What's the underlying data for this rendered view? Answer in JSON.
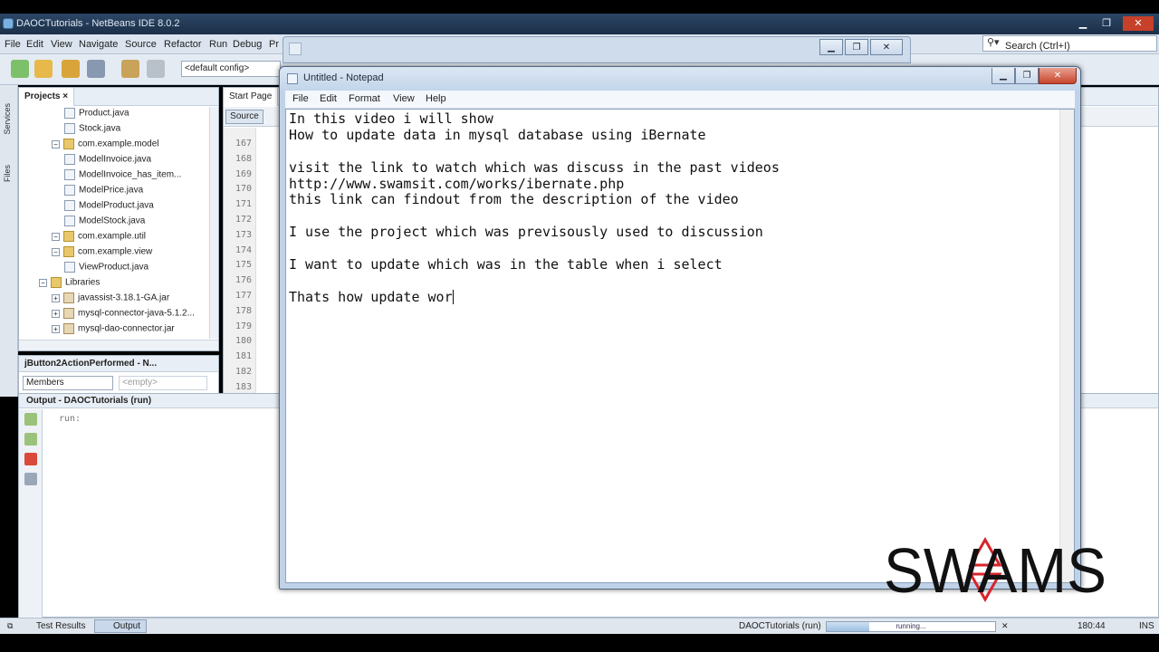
{
  "netbeans": {
    "title": "DAOCTutorials - NetBeans IDE 8.0.2",
    "window_controls": {
      "minimize": "▁",
      "maximize": "❐",
      "close": "✕"
    },
    "menu": [
      "File",
      "Edit",
      "View",
      "Navigate",
      "Source",
      "Refactor",
      "Run",
      "Debug",
      "Pr"
    ],
    "search_placeholder": "Search (Ctrl+I)",
    "config": "<default config>",
    "side_tabs": [
      "Services",
      "Files"
    ],
    "projects": {
      "tab": "Projects ×",
      "tree": [
        {
          "label": "Product.java",
          "type": "file",
          "indent": 3
        },
        {
          "label": "Stock.java",
          "type": "file",
          "indent": 3
        },
        {
          "label": "com.example.model",
          "type": "pkg",
          "indent": 2
        },
        {
          "label": "ModelInvoice.java",
          "type": "file",
          "indent": 3
        },
        {
          "label": "ModelInvoice_has_item...",
          "type": "file",
          "indent": 3
        },
        {
          "label": "ModelPrice.java",
          "type": "file",
          "indent": 3
        },
        {
          "label": "ModelProduct.java",
          "type": "file",
          "indent": 3
        },
        {
          "label": "ModelStock.java",
          "type": "file",
          "indent": 3
        },
        {
          "label": "com.example.util",
          "type": "pkg",
          "indent": 2
        },
        {
          "label": "com.example.view",
          "type": "pkg",
          "indent": 2
        },
        {
          "label": "ViewProduct.java",
          "type": "file",
          "indent": 3
        },
        {
          "label": "Libraries",
          "type": "pkg",
          "indent": 1
        },
        {
          "label": "javassist-3.18.1-GA.jar",
          "type": "jar",
          "indent": 2
        },
        {
          "label": "mysql-connector-java-5.1.2...",
          "type": "jar",
          "indent": 2
        },
        {
          "label": "mysql-dao-connector.jar",
          "type": "jar",
          "indent": 2
        }
      ]
    },
    "navigator": {
      "title": "jButton2ActionPerformed - N...",
      "members": "Members",
      "empty": "<empty>"
    },
    "editor": {
      "tabs": [
        "Start Page"
      ],
      "source_btn": "Source",
      "line_numbers": [
        "167",
        "168",
        "169",
        "170",
        "171",
        "172",
        "173",
        "174",
        "175",
        "176",
        "177",
        "178",
        "179",
        "180",
        "181",
        "182",
        "183"
      ]
    },
    "output": {
      "title": "Output - DAOCTutorials (run)",
      "text": "run:"
    },
    "statusbar": {
      "test_results": "Test Results",
      "output": "Output",
      "project_status": "DAOCTutorials (run)",
      "progress_text": "running...",
      "progress": 0.25,
      "position": "180:44",
      "mode": "INS"
    }
  },
  "notepad": {
    "title": "Untitled - Notepad",
    "menu": [
      "File",
      "Edit",
      "Format",
      "View",
      "Help"
    ],
    "lines": [
      "In this video i will show",
      "How to update data in mysql database using iBernate",
      "",
      "visit the link to watch which was discuss in the past videos",
      "http://www.swamsit.com/works/ibernate.php",
      "this link can findout from the description of the video",
      "",
      "I use the project which was previsously used to discussion",
      "",
      "I want to update which was in the table when i select",
      "",
      "Thats how update wor"
    ]
  },
  "logo": {
    "text": "SWAMS"
  },
  "colors": {
    "ide_chrome": "#dfe6ee",
    "notepad_frame": "#bfd2e8",
    "logo": "#111111",
    "logo_accent": "#d8232a"
  }
}
